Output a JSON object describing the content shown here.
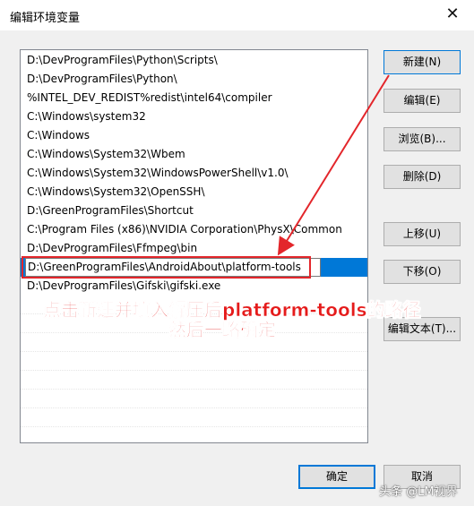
{
  "window": {
    "title": "编辑环境变量",
    "close_glyph": "✕"
  },
  "list": {
    "items": [
      "D:\\DevProgramFiles\\Python\\Scripts\\",
      "D:\\DevProgramFiles\\Python\\",
      "%INTEL_DEV_REDIST%redist\\intel64\\compiler",
      "C:\\Windows\\system32",
      "C:\\Windows",
      "C:\\Windows\\System32\\Wbem",
      "C:\\Windows\\System32\\WindowsPowerShell\\v1.0\\",
      "C:\\Windows\\System32\\OpenSSH\\",
      "D:\\GreenProgramFiles\\Shortcut",
      "C:\\Program Files (x86)\\NVIDIA Corporation\\PhysX\\Common",
      "D:\\DevProgramFiles\\Ffmpeg\\bin",
      "D:\\GreenProgramFiles\\AndroidAbout\\platform-tools",
      "D:\\DevProgramFiles\\Gifski\\gifski.exe"
    ],
    "selected_index": 11
  },
  "buttons": {
    "new": "新建(N)",
    "edit": "编辑(E)",
    "browse": "浏览(B)...",
    "delete": "删除(D)",
    "move_up": "上移(U)",
    "move_down": "下移(O)",
    "edit_text": "编辑文本(T)...",
    "ok": "确定",
    "cancel": "取消"
  },
  "annotation": {
    "line1": "点击新建并填入解压后platform-tools的路径",
    "line2": "然后一路确定",
    "color": "#e51b1b"
  },
  "watermark": "头条 @LM视界",
  "colors": {
    "selection": "#0078d7",
    "accent_border": "#0078d7"
  }
}
